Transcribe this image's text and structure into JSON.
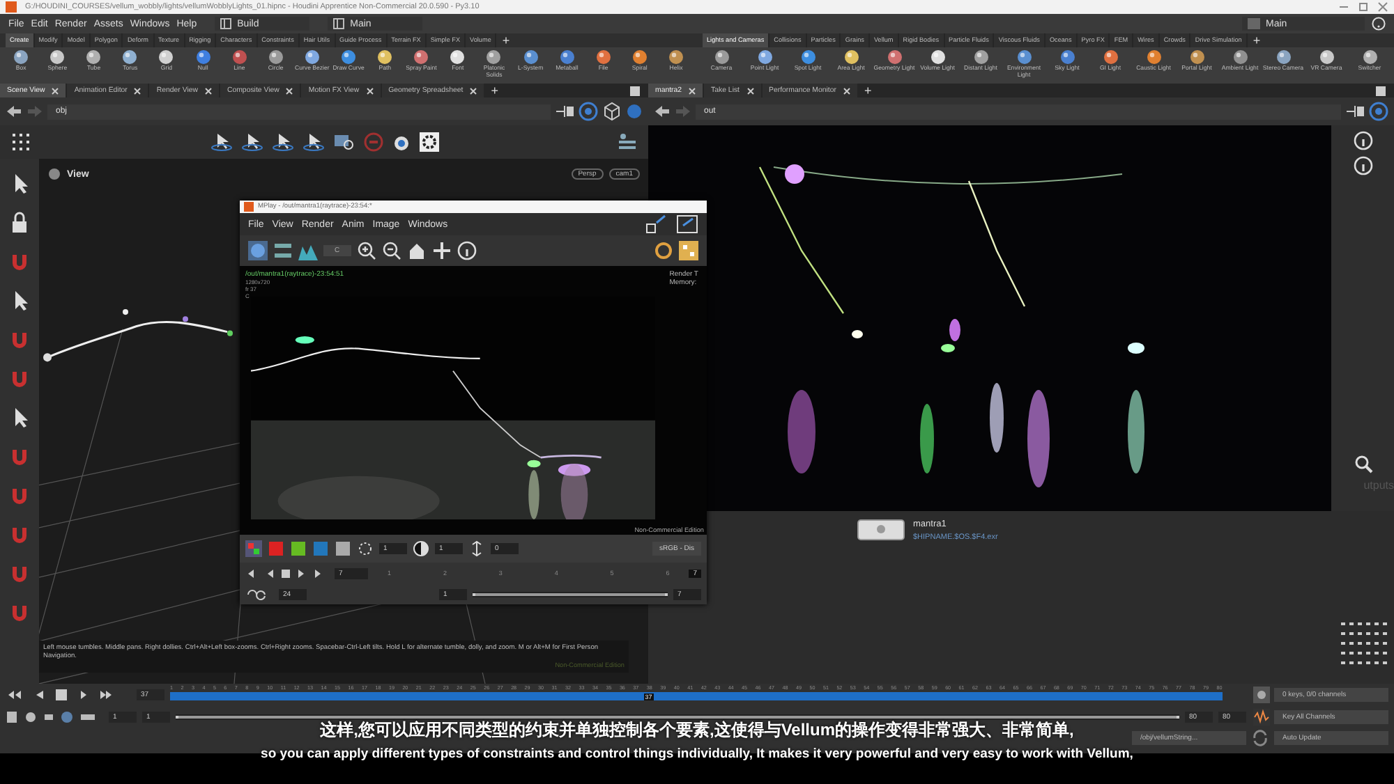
{
  "window": {
    "title": "G:/HOUDINI_COURSES/vellum_wobbly/lights/vellumWobblyLights_01.hipnc - Houdini Apprentice Non-Commercial 20.0.590 - Py3.10"
  },
  "menu": [
    "File",
    "Edit",
    "Render",
    "Assets",
    "Windows",
    "Help"
  ],
  "desktops": [
    "Build",
    "Main"
  ],
  "desktop_right": "Main",
  "shelves": [
    {
      "tabs": [
        {
          "label": "Create",
          "selected": true
        },
        {
          "label": "Modify",
          "selected": false
        },
        {
          "label": "Model",
          "selected": false
        },
        {
          "label": "Polygon",
          "selected": false
        },
        {
          "label": "Deform",
          "selected": false
        },
        {
          "label": "Texture",
          "selected": false
        },
        {
          "label": "Rigging",
          "selected": false
        },
        {
          "label": "Characters",
          "selected": false
        },
        {
          "label": "Constraints",
          "selected": false
        },
        {
          "label": "Hair Utils",
          "selected": false
        },
        {
          "label": "Guide Process",
          "selected": false
        },
        {
          "label": "Terrain FX",
          "selected": false
        },
        {
          "label": "Simple FX",
          "selected": false
        },
        {
          "label": "Volume",
          "selected": false
        }
      ],
      "add": "+",
      "tools": [
        "Box",
        "Sphere",
        "Tube",
        "Torus",
        "Grid",
        "Null",
        "Line",
        "Circle",
        "Curve Bezier",
        "Draw Curve",
        "Path",
        "Spray Paint",
        "Font",
        "Platonic Solids",
        "L-System",
        "Metaball",
        "File",
        "Spiral",
        "Helix"
      ]
    },
    {
      "tabs": [
        {
          "label": "Lights and Cameras",
          "selected": true
        },
        {
          "label": "Collisions",
          "selected": false
        },
        {
          "label": "Particles",
          "selected": false
        },
        {
          "label": "Grains",
          "selected": false
        },
        {
          "label": "Vellum",
          "selected": false
        },
        {
          "label": "Rigid Bodies",
          "selected": false
        },
        {
          "label": "Particle Fluids",
          "selected": false
        },
        {
          "label": "Viscous Fluids",
          "selected": false
        },
        {
          "label": "Oceans",
          "selected": false
        },
        {
          "label": "Pyro FX",
          "selected": false
        },
        {
          "label": "FEM",
          "selected": false
        },
        {
          "label": "Wires",
          "selected": false
        },
        {
          "label": "Crowds",
          "selected": false
        },
        {
          "label": "Drive Simulation",
          "selected": false
        }
      ],
      "add": "+",
      "tools": [
        "Camera",
        "Point Light",
        "Spot Light",
        "Area Light",
        "Geometry Light",
        "Volume Light",
        "Distant Light",
        "Environment Light",
        "Sky Light",
        "GI Light",
        "Caustic Light",
        "Portal Light",
        "Ambient Light",
        "Stereo Camera",
        "VR Camera",
        "Switcher"
      ]
    }
  ],
  "pane_tabs": [
    {
      "tabs": [
        {
          "label": "Scene View",
          "selected": true
        },
        {
          "label": "Animation Editor",
          "selected": false
        },
        {
          "label": "Render View",
          "selected": false
        },
        {
          "label": "Composite View",
          "selected": false
        },
        {
          "label": "Motion FX View",
          "selected": false
        },
        {
          "label": "Geometry Spreadsheet",
          "selected": false
        }
      ],
      "add": "+"
    },
    {
      "tabs": [
        {
          "label": "mantra2",
          "selected": true
        },
        {
          "label": "Take List",
          "selected": false
        },
        {
          "label": "Performance Monitor",
          "selected": false
        }
      ],
      "add": "+"
    }
  ],
  "scene_view": {
    "path": "obj",
    "title": "View",
    "view_buttons": [
      "Persp",
      "cam1"
    ],
    "hint": "Left mouse tumbles. Middle pans. Right dollies. Ctrl+Alt+Left box-zooms. Ctrl+Right zooms. Spacebar-Ctrl-Left tilts. Hold L for alternate tumble, dolly, and zoom. M or Alt+M for First Person Navigation.",
    "edition": "Non-Commercial Edition"
  },
  "render_view": {
    "path": "out",
    "side_label": "utputs"
  },
  "network": {
    "node": {
      "name": "mantra1",
      "output": "$HIPNAME.$OS.$F4.exr"
    }
  },
  "mplay": {
    "title": "MPlay - /out/mantra1(raytrace)-23:54:*",
    "menu": [
      "File",
      "View",
      "Render",
      "Anim",
      "Image",
      "Windows"
    ],
    "channel": "C",
    "info": [
      "/out/mantra1(raytrace)-23:54:51",
      "1280x720",
      "fr 37",
      "C"
    ],
    "stats": [
      "Render T",
      "Memory:"
    ],
    "edition": "Non-Commercial Edition",
    "fields": [
      "1",
      "1",
      "0"
    ],
    "color_space": "sRGB - Dis",
    "frame": "7",
    "ticks": [
      "1",
      "2",
      "3",
      "4",
      "5",
      "6"
    ],
    "marker": "7",
    "fps": "24",
    "range_start": "1",
    "range": {
      "level": 1
    },
    "range_end": "7"
  },
  "timeline": {
    "frame": "37",
    "ticks": [
      "1",
      "2",
      "3",
      "4",
      "5",
      "6",
      "7",
      "8",
      "9",
      "10",
      "11",
      "12",
      "13",
      "14",
      "15",
      "16",
      "17",
      "18",
      "19",
      "20",
      "21",
      "22",
      "23",
      "24",
      "25",
      "26",
      "27",
      "28",
      "29",
      "30",
      "31",
      "32",
      "33",
      "34",
      "35",
      "36",
      "37",
      "38",
      "39",
      "40",
      "41",
      "42",
      "43",
      "44",
      "45",
      "46",
      "47",
      "48",
      "49",
      "50",
      "51",
      "52",
      "53",
      "54",
      "55",
      "56",
      "57",
      "58",
      "59",
      "60",
      "61",
      "62",
      "63",
      "64",
      "65",
      "66",
      "67",
      "68",
      "69",
      "70",
      "71",
      "72",
      "73",
      "74",
      "75",
      "76",
      "77",
      "78",
      "79",
      "80"
    ],
    "marker": "37",
    "start": "1",
    "range_start": "1",
    "range": {
      "level": 1
    },
    "range_end": "80",
    "end": "80",
    "keys": "0 keys, 0/0 channels",
    "key_mode": "Key All Channels",
    "object": "/obj/vellumString...",
    "update": "Auto Update"
  },
  "subtitles": {
    "zh": "这样,您可以应用不同类型的约束并单独控制各个要素,这使得与Vellum的操作变得非常强大、非常简单,",
    "en": "so you can apply different types of constraints and control things individually, It makes it very powerful and very easy to work with Vellum,"
  }
}
